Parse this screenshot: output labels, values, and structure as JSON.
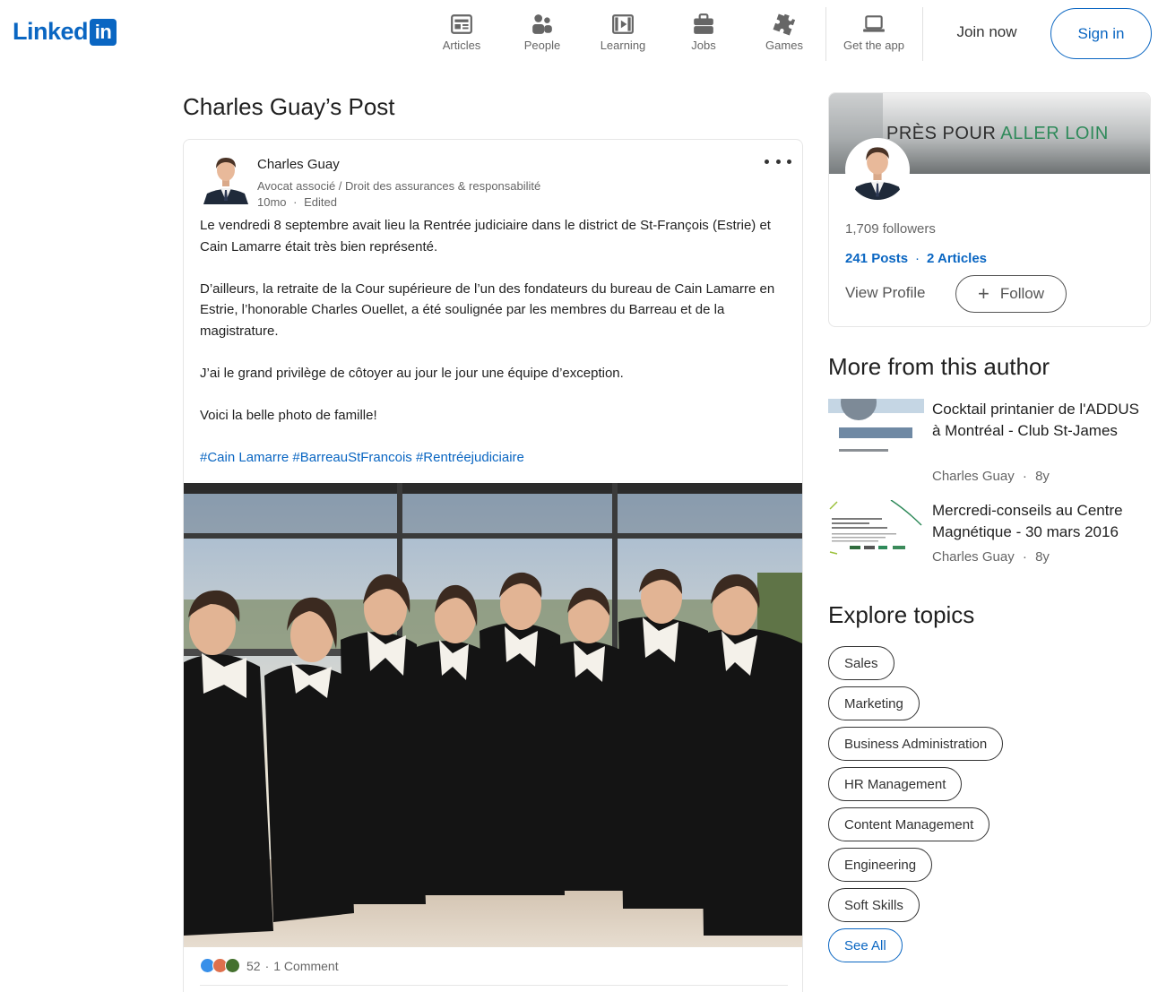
{
  "header": {
    "logo_text": "Linked",
    "logo_badge": "in",
    "nav": [
      {
        "label": "Articles",
        "icon": "articles-icon"
      },
      {
        "label": "People",
        "icon": "people-icon"
      },
      {
        "label": "Learning",
        "icon": "learning-icon"
      },
      {
        "label": "Jobs",
        "icon": "jobs-icon"
      },
      {
        "label": "Games",
        "icon": "games-icon"
      }
    ],
    "get_app": {
      "label": "Get the app",
      "icon": "laptop-icon"
    },
    "join_label": "Join now",
    "signin_label": "Sign in"
  },
  "page_title": "Charles Guay’s Post",
  "post": {
    "author": {
      "name": "Charles Guay",
      "headline": "Avocat associé / Droit des assurances & responsabilité",
      "time": "10mo",
      "edited": "Edited",
      "separator": "·"
    },
    "paragraphs": [
      "Le vendredi 8 septembre avait lieu la Rentrée judiciaire dans le district de St-François (Estrie) et Cain Lamarre était très bien représenté.",
      "D’ailleurs, la retraite de la Cour supérieure de l’un des fondateurs du bureau de Cain Lamarre en Estrie, l’honorable Charles Ouellet, a été soulignée par les membres du Barreau et de la magistrature.",
      "J’ai le grand privilège de côtoyer au jour le jour une équipe d’exception.",
      "Voici la belle photo de famille!"
    ],
    "hashtags": [
      "#Cain Lamarre",
      "#BarreauStFrancois",
      "#Rentréejudiciaire"
    ],
    "reactions": {
      "count": "52",
      "separator": "·",
      "comments": "1 Comment",
      "icons": [
        "like-icon",
        "love-icon",
        "celebrate-icon"
      ]
    }
  },
  "profile": {
    "cover_text_part1": "PRÈS POUR ",
    "cover_text_part2": "ALLER LOIN",
    "followers": "1,709 followers",
    "posts": "241 Posts",
    "stats_separator": "·",
    "articles": "2 Articles",
    "view_profile": "View Profile",
    "follow_plus": "+",
    "follow_label": "Follow"
  },
  "more_from_author": {
    "title": "More from this author",
    "articles": [
      {
        "title": "Cocktail printanier de l'ADDUS à Montréal - Club St-James",
        "author": "Charles Guay",
        "separator": "·",
        "age": "8y"
      },
      {
        "title": "Mercredi-conseils au Centre Magnétique - 30 mars 2016",
        "author": "Charles Guay",
        "separator": "·",
        "age": "8y"
      }
    ]
  },
  "explore_topics": {
    "title": "Explore topics",
    "topics": [
      "Sales",
      "Marketing",
      "Business Administration",
      "HR Management",
      "Content Management",
      "Engineering",
      "Soft Skills"
    ],
    "see_all": "See All"
  },
  "colors": {
    "brand": "#0a66c2",
    "text": "#1f1f1f",
    "muted": "#666666",
    "cover_green": "#2f8a5a"
  }
}
